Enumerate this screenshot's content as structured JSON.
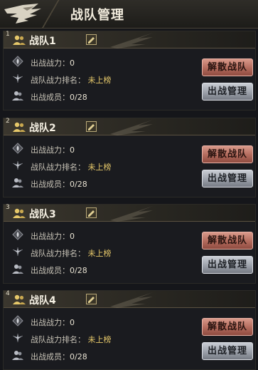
{
  "header": {
    "title": "战队管理"
  },
  "squads": [
    {
      "index": "1",
      "name": "战队1",
      "power_label": "出战战力：",
      "power_value": "0",
      "rank_label": "战队战力排名：",
      "rank_value": "未上榜",
      "members_label": "出战成员：",
      "members_value": "0/28",
      "disband_label": "解散战队",
      "manage_label": "出战管理"
    },
    {
      "index": "2",
      "name": "战队2",
      "power_label": "出战战力：",
      "power_value": "0",
      "rank_label": "战队战力排名：",
      "rank_value": "未上榜",
      "members_label": "出战成员：",
      "members_value": "0/28",
      "disband_label": "解散战队",
      "manage_label": "出战管理"
    },
    {
      "index": "3",
      "name": "战队3",
      "power_label": "出战战力：",
      "power_value": "0",
      "rank_label": "战队战力排名：",
      "rank_value": "未上榜",
      "members_label": "出战成员：",
      "members_value": "0/28",
      "disband_label": "解散战队",
      "manage_label": "出战管理"
    },
    {
      "index": "4",
      "name": "战队4",
      "power_label": "出战战力：",
      "power_value": "0",
      "rank_label": "战队战力排名：",
      "rank_value": "未上榜",
      "members_label": "出战成员：",
      "members_value": "0/28",
      "disband_label": "解散战队",
      "manage_label": "出战管理"
    }
  ],
  "icons": {
    "header": "eagle-emblem-icon",
    "squad": "people-icon",
    "edit": "edit-icon",
    "power": "flame-icon",
    "rank": "rank-wings-icon",
    "members": "members-icon"
  },
  "colors": {
    "gold_text": "#e6c86a",
    "disband_button": "#b26a5c",
    "manage_button": "#9ca1aa"
  }
}
